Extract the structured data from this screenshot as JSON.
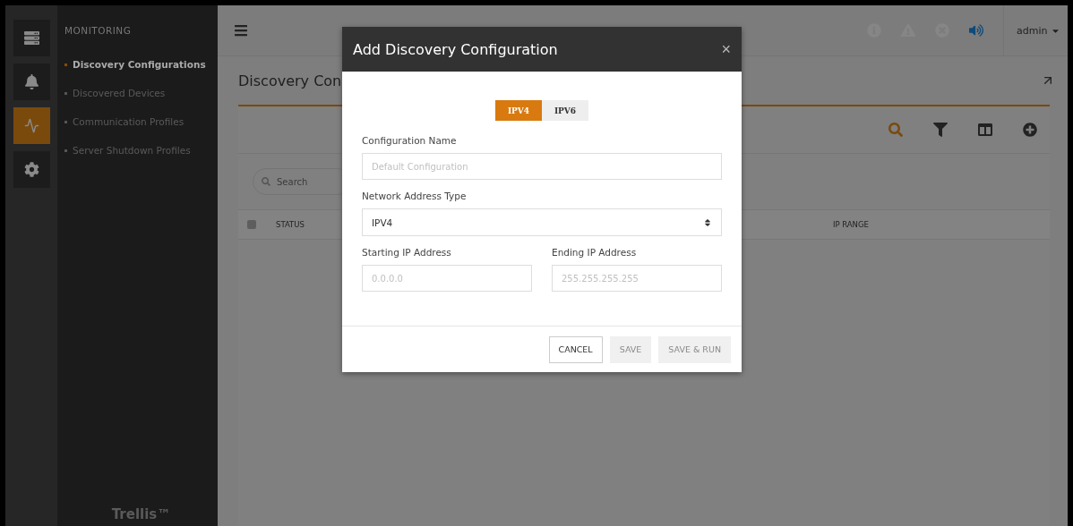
{
  "rail": [
    {
      "kind": "servers",
      "selected": false
    },
    {
      "kind": "alarm",
      "selected": false
    },
    {
      "kind": "pulse",
      "selected": true
    },
    {
      "kind": "settings",
      "selected": false
    }
  ],
  "nav": {
    "heading": "MONITORING",
    "items": [
      {
        "label": "Discovery Configurations",
        "selected": true
      },
      {
        "label": "Discovered Devices",
        "selected": false
      },
      {
        "label": "Communication Profiles",
        "selected": false
      },
      {
        "label": "Server Shutdown Profiles",
        "selected": false
      }
    ],
    "brand": "Trellis™"
  },
  "header": {
    "user": "admin"
  },
  "page": {
    "title": "Discovery Con",
    "search": {
      "placeholder": "Search"
    },
    "select_all": {
      "checked": false
    },
    "columns": [
      "STATUS",
      "IP RANGE"
    ]
  },
  "dialog": {
    "title": "Add Discovery Configuration",
    "close": "×",
    "tabs": [
      {
        "label": "IPV4",
        "selected": true
      },
      {
        "label": "IPV6",
        "selected": false
      }
    ],
    "fields": [
      {
        "kind": "text",
        "label": "Configuration Name",
        "placeholder": "Default Configuration"
      },
      {
        "kind": "select",
        "label": "Network Address Type",
        "value": "IPV4"
      }
    ],
    "range": [
      {
        "label": "Starting IP Address",
        "placeholder": "0.0.0.0"
      },
      {
        "label": "Ending IP Address",
        "placeholder": "255.255.255.255"
      }
    ],
    "buttons": [
      {
        "label": "CANCEL",
        "disabled": false
      },
      {
        "label": "SAVE",
        "disabled": true
      },
      {
        "label": "SAVE & RUN",
        "disabled": true
      }
    ]
  }
}
